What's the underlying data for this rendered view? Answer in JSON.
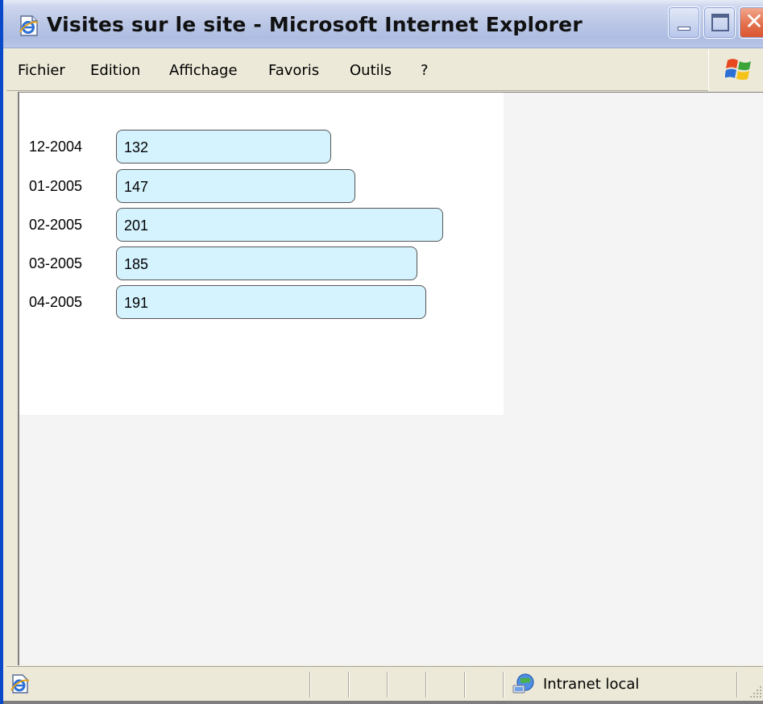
{
  "window": {
    "title": "Visites sur le site - Microsoft Internet Explorer"
  },
  "menu": {
    "items": [
      "Fichier",
      "Edition",
      "Affichage",
      "Favoris",
      "Outils",
      "?"
    ]
  },
  "page": {
    "rows": [
      {
        "label": "12-2004",
        "value": "132"
      },
      {
        "label": "01-2005",
        "value": "147"
      },
      {
        "label": "02-2005",
        "value": "201"
      },
      {
        "label": "03-2005",
        "value": "185"
      },
      {
        "label": "04-2005",
        "value": "191"
      }
    ],
    "bar_color": "#d5f3ff"
  },
  "statusbar": {
    "zone": "Intranet local"
  },
  "icons": {
    "title": "ie-page-icon",
    "throbber": "windows-logo-icon",
    "status": "ie-page-icon",
    "zone": "intranet-globe-icon"
  }
}
